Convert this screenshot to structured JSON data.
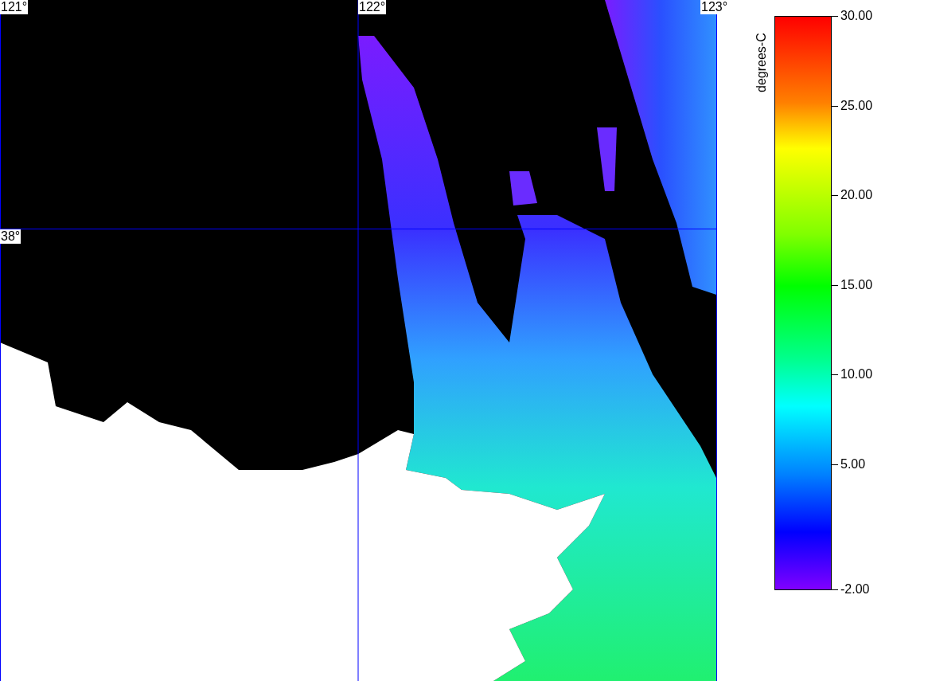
{
  "map": {
    "longitude_labels": [
      "121°",
      "122°",
      "123°"
    ],
    "latitude_labels": [
      "38°"
    ]
  },
  "legend": {
    "title": "degrees-C",
    "ticks": [
      "30.00",
      "25.00",
      "20.00",
      "15.00",
      "10.00",
      "5.00",
      "-2.00"
    ]
  }
}
